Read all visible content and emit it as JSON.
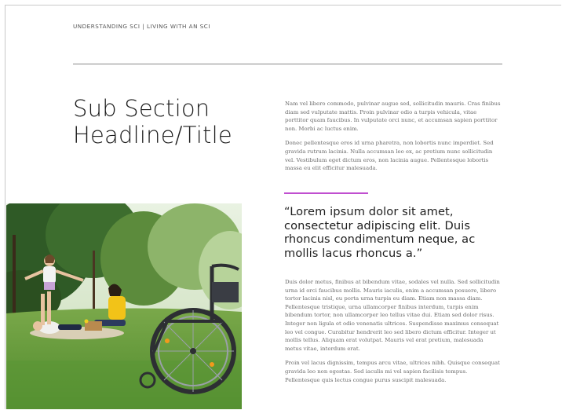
{
  "header": {
    "breadcrumb": "UNDERSTANDING SCI | LIVING WITH AN SCI"
  },
  "section": {
    "title": "Sub Section Headline/Title",
    "intro_paragraphs": [
      "Nam vel libero commodo, pulvinar augue sed, sollicitudin mauris. Cras finibus diam sed vulputate mattis. Proin pulvinar odio a turpis vehicula, vitae porttitor quam faucibus. In vulputate orci nunc, et accumsan sapien porttitor non. Morbi ac luctus enim.",
      "Donec pellentesque eros id urna pharetra, non lobortis nunc imperdiet. Sed gravida rutrum lacinia. Nulla accumsan leo ex, ac pretium nunc sollicitudin vel. Vestibulum eget dictum eros, non lacinia augue. Pellentesque lobortis massa eu elit efficitur malesuada."
    ],
    "pull_quote": "“Lorem ipsum dolor sit amet, consectetur adipiscing elit. Duis rhoncus condimentum neque, ac mollis lacus rhoncus a.”",
    "body_paragraphs": [
      "Duis dolor metus, finibus at bibendum vitae, sodales vel nulla. Sed sollicitudin urna id orci faucibus mollis. Mauris iaculis, enim a accumsan posuere, libero tortor lacinia nisl, eu porta urna turpis eu diam. Etiam non massa diam. Pellentesque tristique, urna ullamcorper finibus interdum, turpis enim bibendum tortor, non ullamcorper leo tellus vitae dui. Etiam sed dolor risus. Integer non ligula et odio venenatis ultrices. Suspendisse maximus consequat leo vel congue. Curabitur hendrerit leo sed libero dictum efficitur. Integer ut mollis tellus. Aliquam erat volutpat. Mauris vel erat pretium, malesuada metus vitae, interdum erat.",
      "Proin vel lacus dignissim, tempus arcu vitae, ultrices nibh. Quisque consequat gravida leo non egestas. Sed iaculis mi vel sapien facilisis tempus. Pellentesque quis lectus congue purus suscipit malesuada."
    ]
  },
  "photo": {
    "subject": "family-in-park-with-wheelchair"
  },
  "colors": {
    "accent": "#c04fd0",
    "rule": "#8a8a8a",
    "body_text": "#6a6a6a"
  }
}
